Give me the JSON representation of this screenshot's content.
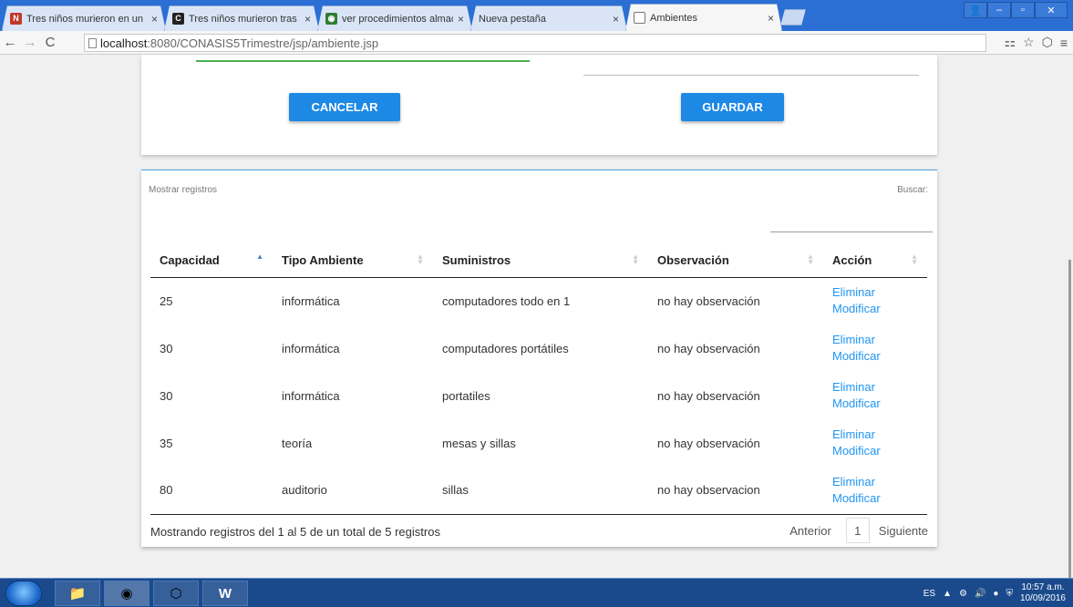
{
  "browser": {
    "tabs": [
      {
        "title": "Tres niños murieron en un",
        "favicon": "news-icon",
        "color": "#c0392b"
      },
      {
        "title": "Tres niños murieron tras i",
        "favicon": "c-logo-icon",
        "color": "#222222"
      },
      {
        "title": "ver procedimientos almac",
        "favicon": "db-icon",
        "color": "#2e7d32"
      },
      {
        "title": "Nueva pestaña",
        "favicon": "",
        "color": ""
      },
      {
        "title": "Ambientes",
        "favicon": "page-icon",
        "color": ""
      }
    ],
    "address": {
      "host": "localhost",
      "path": ":8080/CONASIS5Trimestre/jsp/ambiente.jsp"
    }
  },
  "form": {
    "cancel_label": "CANCELAR",
    "save_label": "GUARDAR"
  },
  "table": {
    "show_records_label": "Mostrar registros",
    "search_label": "Buscar:",
    "headers": [
      "Capacidad",
      "Tipo Ambiente",
      "Suministros",
      "Observación",
      "Acción"
    ],
    "rows": [
      {
        "capacidad": "25",
        "tipo": "informática",
        "suministros": "computadores todo en 1",
        "observacion": "no hay observación"
      },
      {
        "capacidad": "30",
        "tipo": "informática",
        "suministros": "computadores portátiles",
        "observacion": "no hay observación"
      },
      {
        "capacidad": "30",
        "tipo": "informática",
        "suministros": "portatiles",
        "observacion": "no hay observación"
      },
      {
        "capacidad": "35",
        "tipo": "teoría",
        "suministros": "mesas y sillas",
        "observacion": "no hay observación"
      },
      {
        "capacidad": "80",
        "tipo": "auditorio",
        "suministros": "sillas",
        "observacion": "no hay observacion"
      }
    ],
    "action_delete": "Eliminar",
    "action_edit": "Modificar",
    "footer_info": "Mostrando registros del 1 al 5 de un total de 5 registros",
    "pager": {
      "prev": "Anterior",
      "page": "1",
      "next": "Siguiente"
    }
  },
  "taskbar": {
    "lang": "ES",
    "time": "10:57 a.m.",
    "date": "10/09/2016"
  },
  "colors": {
    "accent": "#1e88e5",
    "link": "#2196f3",
    "input_focus": "#4caf50"
  }
}
